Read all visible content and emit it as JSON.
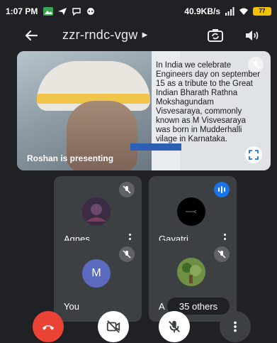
{
  "status_bar": {
    "time": "1:07 PM",
    "network_speed": "40.9KB/s",
    "battery_level": "77"
  },
  "header": {
    "meeting_code": "zzr-rndc-vgw",
    "icons": [
      "back-arrow-icon",
      "switch-camera-icon",
      "speaker-icon"
    ]
  },
  "presentation": {
    "slide_text": "In India we celebrate Engineers day on september 15 as a tribute to the Great Indian Bharath Rathna Mokshagundam Visvesaraya, commonly known as M Visvesaraya was born in Mudderhalli vilage in Karnataka.",
    "presenter_label": "Roshan is presenting"
  },
  "participants": [
    {
      "name": "Agnes",
      "muted": true
    },
    {
      "name": "Gayatri",
      "speaking": true
    },
    {
      "name": "You",
      "initial": "M",
      "muted": true
    },
    {
      "name": "A",
      "muted": true,
      "others_label": "35 others"
    }
  ],
  "controls": [
    "end-call",
    "camera-off",
    "mic-off",
    "more-options"
  ],
  "colors": {
    "background": "#202124",
    "tile": "#3c4043",
    "end_call": "#ea4335",
    "accent": "#1a73e8",
    "you_avatar": "#5c6bc0"
  }
}
